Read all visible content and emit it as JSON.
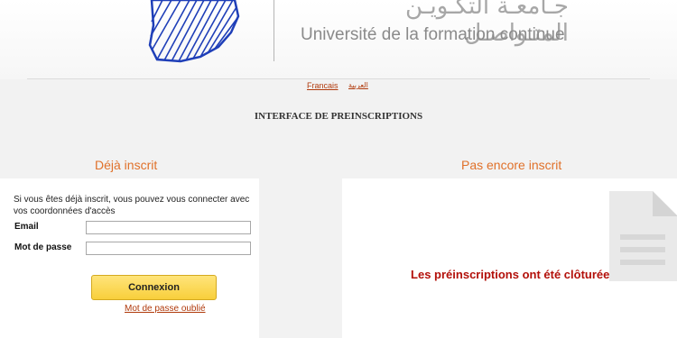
{
  "header": {
    "name_ar": "جـامعـة التكـويـن المتـواصـل",
    "name_fr": "Université de la formation continue"
  },
  "languages": [
    {
      "label": "Francais"
    },
    {
      "label": "العربية"
    }
  ],
  "page_title": "INTERFACE DE PREINSCRIPTIONS",
  "login_section": {
    "title": "Déjà inscrit",
    "intro": "Si vous êtes déjà inscrit, vous pouvez vous connecter avec vos coordonnées d'accès",
    "email_label": "Email",
    "email_value": "",
    "password_label": "Mot de passe",
    "password_value": "",
    "submit_label": "Connexion",
    "forgot_label": "Mot de passe oublié"
  },
  "register_section": {
    "title": "Pas encore inscrit",
    "closed_message": "Les préinscriptions ont été clôturées!"
  },
  "colors": {
    "section_title": "#e0712a",
    "link": "#b03a0c",
    "alert": "#b3100a",
    "button": "#f8cf3b",
    "logo_blue": "#1f3fb8"
  }
}
